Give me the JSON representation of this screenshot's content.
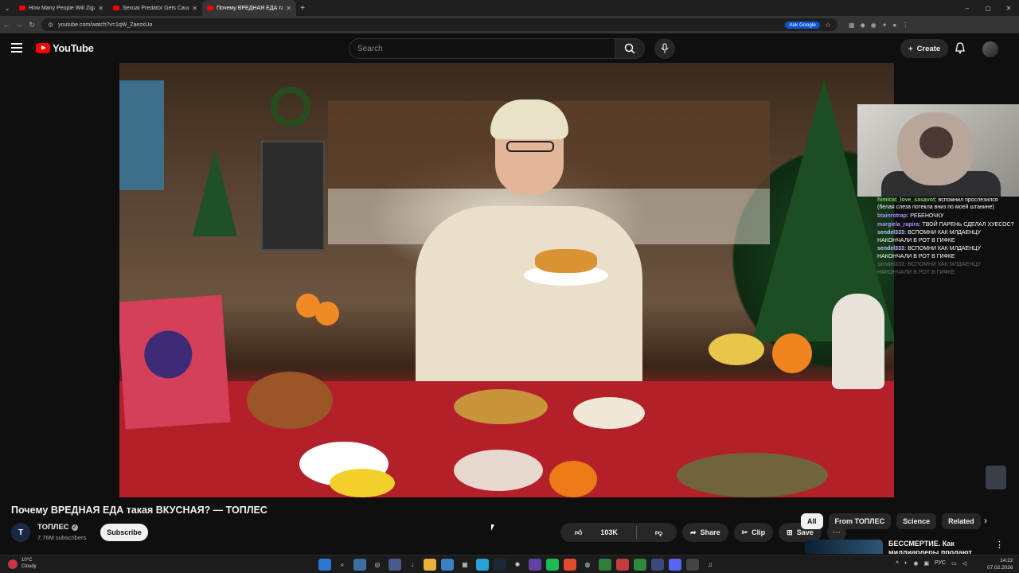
{
  "browser": {
    "tabs": [
      {
        "title": "How Many People Will Zigant S"
      },
      {
        "title": "Sexual Predator Gets Caught in"
      },
      {
        "title": "Почему ВРЕДНАЯ ЕДА такая В"
      }
    ],
    "url": "youtube.com/watch?v=1qW_ZaezxUo",
    "ask_google_label": "Ask Google"
  },
  "header": {
    "logo_text": "YouTube",
    "search_placeholder": "Search",
    "create_label": "Create"
  },
  "video": {
    "title": "Почему ВРЕДНАЯ ЕДА такая ВКУСНАЯ? — ТОПЛЕС",
    "channel_name": "ТОПЛЕС",
    "channel_initial": "T",
    "subscribers": "7.76M subscribers",
    "subscribe_label": "Subscribe",
    "likes": "103K",
    "share_label": "Share",
    "clip_label": "Clip",
    "save_label": "Save"
  },
  "chips": [
    {
      "label": "All",
      "selected": true
    },
    {
      "label": "From ТОПЛЕС",
      "selected": false
    },
    {
      "label": "Science",
      "selected": false
    },
    {
      "label": "Related",
      "selected": false
    }
  ],
  "recommendation": {
    "title": "БЕССМЕРТИЕ. Как миллиардеры продают"
  },
  "chat": [
    {
      "user": "himicat_love_sasavot:",
      "user_color": "#7cd35b",
      "text": "вспомнил прослезился (белая слеза потекла вниз по моей штанине)",
      "faded": false
    },
    {
      "user": "btainrotrap:",
      "user_color": "#b48cff",
      "text": "РЕБЕНОЧКУ",
      "faded": false
    },
    {
      "user": "margiela_rapira:",
      "user_color": "#b48cff",
      "text": "ТВОЙ ПАРЕНЬ СДЕЛАЛ ХУЕСОС?",
      "faded": false
    },
    {
      "user": "sendel333:",
      "user_color": "#b6c7ff",
      "text": "ВСПОМНИ КАК МЛДАЕНЦУ НАКОНЧАЛИ В РОТ В ГИФКЕ",
      "faded": false
    },
    {
      "user": "sendel333:",
      "user_color": "#b6c7ff",
      "text": "ВСПОМНИ КАК МЛДАЕНЦУ НАКОНЧАЛИ В РОТ В ГИФКЕ",
      "faded": false
    },
    {
      "user": "sendel333:",
      "user_color": "#b6c7ff",
      "text": "ВСПОМНИ КАК МЛДАЕНЦУ НАКОНЧАЛИ В РОТ В ГИФКЕ",
      "faded": true
    }
  ],
  "taskbar": {
    "temperature": "10°C",
    "weather": "Cloudy",
    "language": "РУС",
    "time": "14:22",
    "date": "07.02.2026"
  },
  "colors": {
    "youtube_red": "#ff0000",
    "accent_blue": "#0b57d0"
  }
}
